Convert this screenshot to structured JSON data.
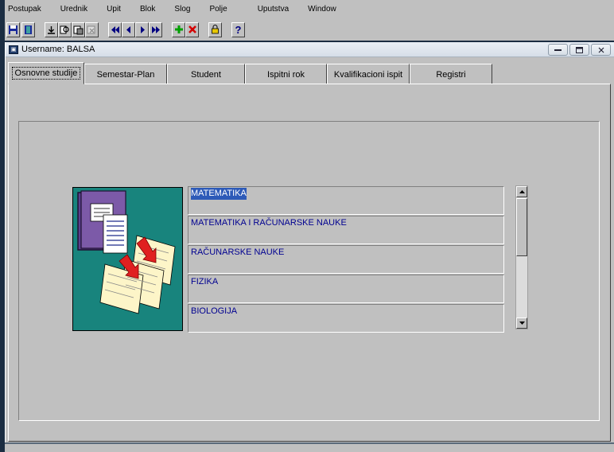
{
  "menu": [
    {
      "label": "Postupak"
    },
    {
      "label": "Urednik"
    },
    {
      "label": "Upit"
    },
    {
      "label": "Blok"
    },
    {
      "label": "Slog"
    },
    {
      "label": "Polje"
    },
    {
      "label": "Uputstva"
    },
    {
      "label": "Window"
    }
  ],
  "toolbar": {
    "buttons": [
      {
        "icon": "save-icon"
      },
      {
        "icon": "exit-door-icon"
      },
      {
        "icon": "enter-query-icon"
      },
      {
        "icon": "execute-query-icon"
      },
      {
        "icon": "count-query-icon"
      },
      {
        "icon": "cancel-query-icon"
      },
      {
        "icon": "first-record-icon"
      },
      {
        "icon": "previous-record-icon"
      },
      {
        "icon": "next-record-icon"
      },
      {
        "icon": "last-record-icon"
      },
      {
        "icon": "insert-record-icon"
      },
      {
        "icon": "delete-record-icon"
      },
      {
        "icon": "lock-record-icon"
      },
      {
        "icon": "help-icon"
      }
    ],
    "help_glyph": "?"
  },
  "window": {
    "title": "Username: BALSA",
    "tabs": [
      {
        "label": "Osnovne studije",
        "active": true
      },
      {
        "label": "Semestar-Plan"
      },
      {
        "label": "Student"
      },
      {
        "label": "Ispitni rok"
      },
      {
        "label": "Kvalifikacioni ispit"
      },
      {
        "label": "Registri"
      }
    ]
  },
  "records": [
    {
      "value": "MATEMATIKA",
      "selected": true
    },
    {
      "value": "MATEMATIKA I RAČUNARSKE NAUKE"
    },
    {
      "value": "RAČUNARSKE NAUKE"
    },
    {
      "value": "FIZIKA"
    },
    {
      "value": "BIOLOGIJA"
    }
  ],
  "colors": {
    "desktop": "#1b2d42",
    "panel": "#c0c0c0",
    "record_text": "#000090",
    "selection": "#2d5ab8",
    "illustration_bg": "#18847d"
  }
}
